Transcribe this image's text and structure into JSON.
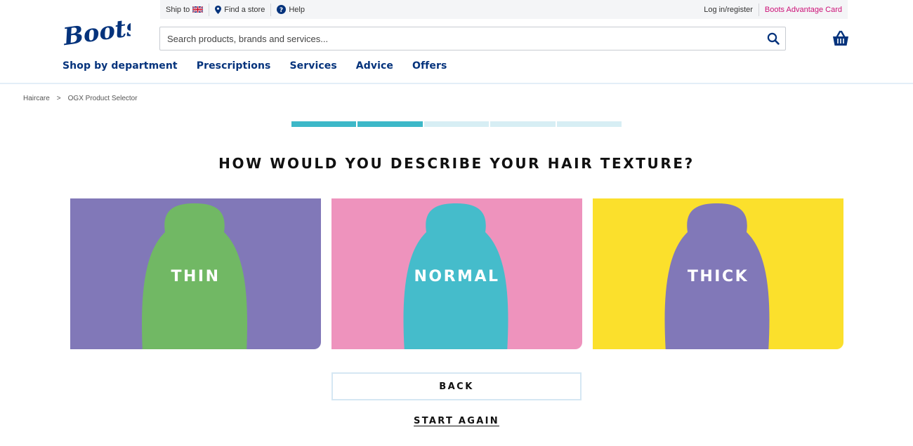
{
  "utility": {
    "ship_to": "Ship to",
    "find_store": "Find a store",
    "help": "Help",
    "login": "Log in/register",
    "advantage_card": "Boots Advantage Card"
  },
  "logo": {
    "text": "Boots"
  },
  "search": {
    "placeholder": "Search products, brands and services..."
  },
  "nav": {
    "items": [
      "Shop by department",
      "Prescriptions",
      "Services",
      "Advice",
      "Offers"
    ]
  },
  "breadcrumb": {
    "items": [
      "Haircare",
      "OGX Product Selector"
    ],
    "separator": ">"
  },
  "progress": {
    "current_step": 2,
    "total_steps": 5
  },
  "question": "HOW WOULD YOU DESCRIBE YOUR HAIR TEXTURE?",
  "options": [
    {
      "label": "THIN",
      "bg_color": "#8178b8",
      "shape_color": "#71b864"
    },
    {
      "label": "NORMAL",
      "bg_color": "#ee93bd",
      "shape_color": "#45bccb"
    },
    {
      "label": "THICK",
      "bg_color": "#fbe02c",
      "shape_color": "#8178b8"
    }
  ],
  "buttons": {
    "back": "BACK",
    "start_again": "START AGAIN"
  },
  "colors": {
    "brand_blue": "#05337c",
    "accent_pink": "#cc1177",
    "progress_done": "#3db8c8",
    "progress_todo": "#d7eef4"
  }
}
